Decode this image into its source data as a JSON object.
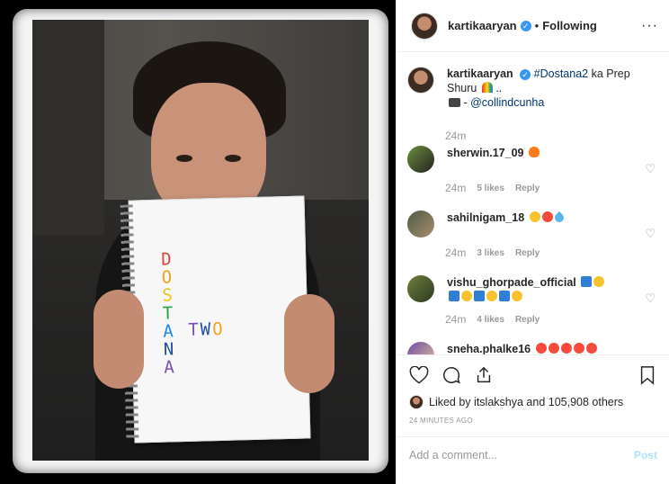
{
  "header": {
    "username": "kartikaaryan",
    "separator": "•",
    "follow_status": "Following",
    "more": "···"
  },
  "caption": {
    "username": "kartikaaryan",
    "hashtag": "#Dostana2",
    "text": " ka Prep Shuru",
    "ellipsis": " ..",
    "credit_prefix": " - ",
    "mention": "@collindcunha",
    "time": "24m"
  },
  "comments": [
    {
      "username": "sherwin.17_09",
      "emojis": [
        "fire"
      ],
      "time": "24m",
      "likes": "5 likes",
      "reply": "Reply"
    },
    {
      "username": "sahilnigam_18",
      "emojis": [
        "cool",
        "heart-eyes",
        "blue-heart"
      ],
      "time": "24m",
      "likes": "3 likes",
      "reply": "Reply"
    },
    {
      "username": "vishu_ghorpade_official",
      "emojis": [
        "anchor",
        "wink",
        "anchor",
        "wink",
        "anchor",
        "wink",
        "anchor",
        "wink"
      ],
      "time": "24m",
      "likes": "4 likes",
      "reply": "Reply"
    },
    {
      "username": "sneha.phalke16",
      "emojis": [
        "heart-eyes",
        "heart-eyes",
        "heart-eyes",
        "heart-eyes",
        "heart-eyes"
      ]
    }
  ],
  "likes": {
    "prefix": "Liked by ",
    "first_user": "itslakshya",
    "middle": " and ",
    "others": "105,908 others"
  },
  "timestamp": "24 MINUTES AGO",
  "add_comment": {
    "placeholder": "Add a comment...",
    "post_label": "Post"
  },
  "notebook": {
    "letters": [
      "D",
      "O",
      "S",
      "T",
      "A",
      "N",
      "A"
    ],
    "letter_colors": [
      "#e0453a",
      "#f2a21d",
      "#f0c419",
      "#2aa24a",
      "#1e88e5",
      "#1e4fa3",
      "#7a4fb5"
    ],
    "two_letters": [
      "T",
      "W",
      "O"
    ],
    "two_colors": [
      "#7a4fb5",
      "#1e4fa3",
      "#f2a21d"
    ]
  },
  "colors": {
    "accent": "#3897f0",
    "link": "#003569",
    "muted": "#999999",
    "post_disabled": "#b2dffc"
  }
}
